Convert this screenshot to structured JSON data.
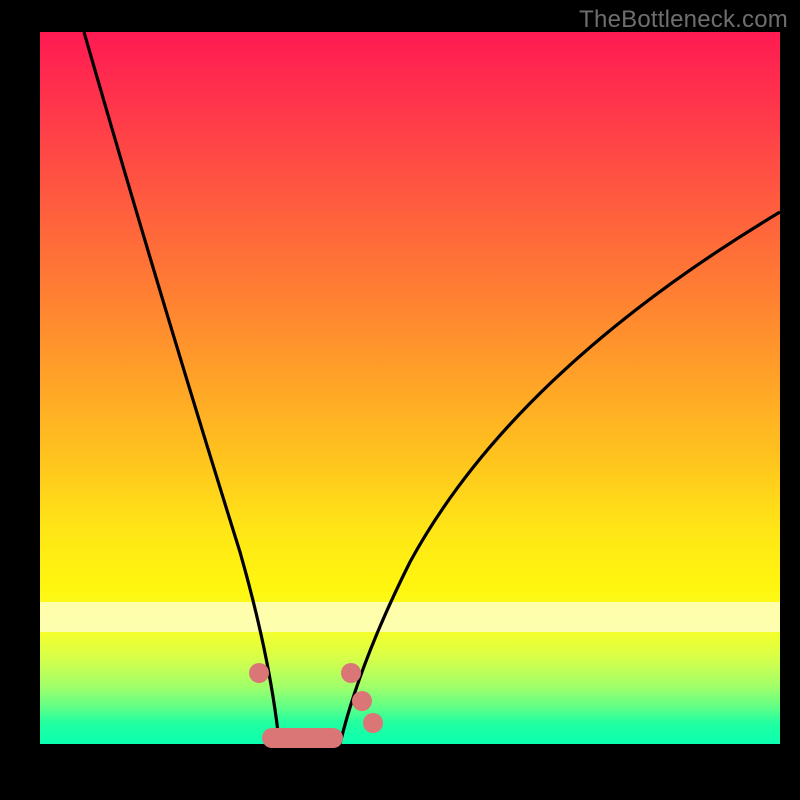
{
  "watermark": "TheBottleneck.com",
  "colors": {
    "page_bg": "#000000",
    "marker": "#db7676",
    "curve": "#000000",
    "gradient_top": "#ff1a52",
    "gradient_bottom": "#0affb0"
  },
  "chart_data": {
    "type": "line",
    "title": "",
    "xlabel": "",
    "ylabel": "",
    "xlim": [
      0,
      100
    ],
    "ylim": [
      0,
      100
    ],
    "grid": false,
    "legend": false,
    "annotations": [
      "TheBottleneck.com"
    ],
    "series": [
      {
        "name": "left-curve",
        "x": [
          6,
          10,
          14,
          18,
          22,
          24,
          26,
          28,
          29,
          30,
          31,
          32
        ],
        "y": [
          100,
          84,
          70,
          56,
          40,
          30,
          20,
          10,
          5,
          2,
          1,
          0
        ]
      },
      {
        "name": "right-curve",
        "x": [
          40,
          42,
          44,
          48,
          52,
          58,
          66,
          76,
          88,
          100
        ],
        "y": [
          0,
          4,
          10,
          20,
          30,
          40,
          50,
          60,
          68,
          74
        ]
      }
    ],
    "markers": {
      "name": "highlight-points",
      "points": [
        {
          "x": 29.5,
          "y": 10
        },
        {
          "x": 42.0,
          "y": 10
        },
        {
          "x": 43.5,
          "y": 6
        },
        {
          "x": 45.0,
          "y": 3
        }
      ],
      "floor_bar": {
        "x_start": 30,
        "x_end": 41,
        "y": 0.8
      }
    }
  }
}
